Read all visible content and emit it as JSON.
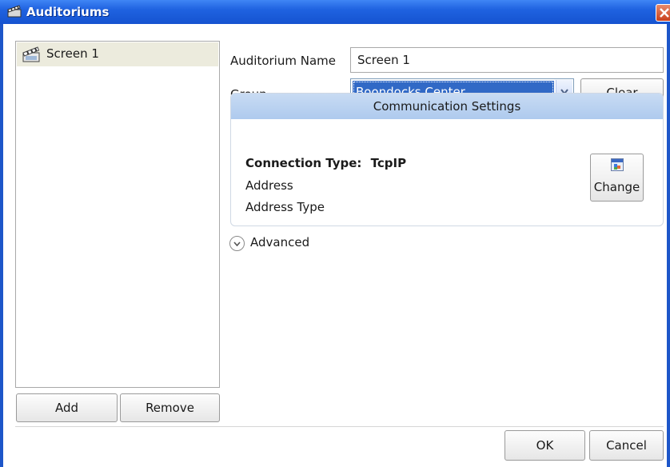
{
  "window": {
    "title": "Auditoriums"
  },
  "list": {
    "items": [
      {
        "label": "Screen 1",
        "icon": "clapperboard-icon"
      }
    ],
    "add_label": "Add",
    "remove_label": "Remove"
  },
  "form": {
    "name_label": "Auditorium Name",
    "name_value": "Screen 1",
    "group_label": "Group",
    "group_value": "Boondocks Center",
    "clear_label": "Clear"
  },
  "comm": {
    "header": "Communication Settings",
    "connection_type_label": "Connection Type:",
    "connection_type_value": "TcpIP",
    "address_label": "Address",
    "address_type_label": "Address Type",
    "change_label": "Change"
  },
  "advanced_label": "Advanced",
  "footer": {
    "ok_label": "OK",
    "cancel_label": "Cancel"
  },
  "colors": {
    "titlebar": "#1f62e0",
    "selection": "#3169c6",
    "comm_header": "#bcd3f0",
    "list_selected": "#ecebdd"
  }
}
